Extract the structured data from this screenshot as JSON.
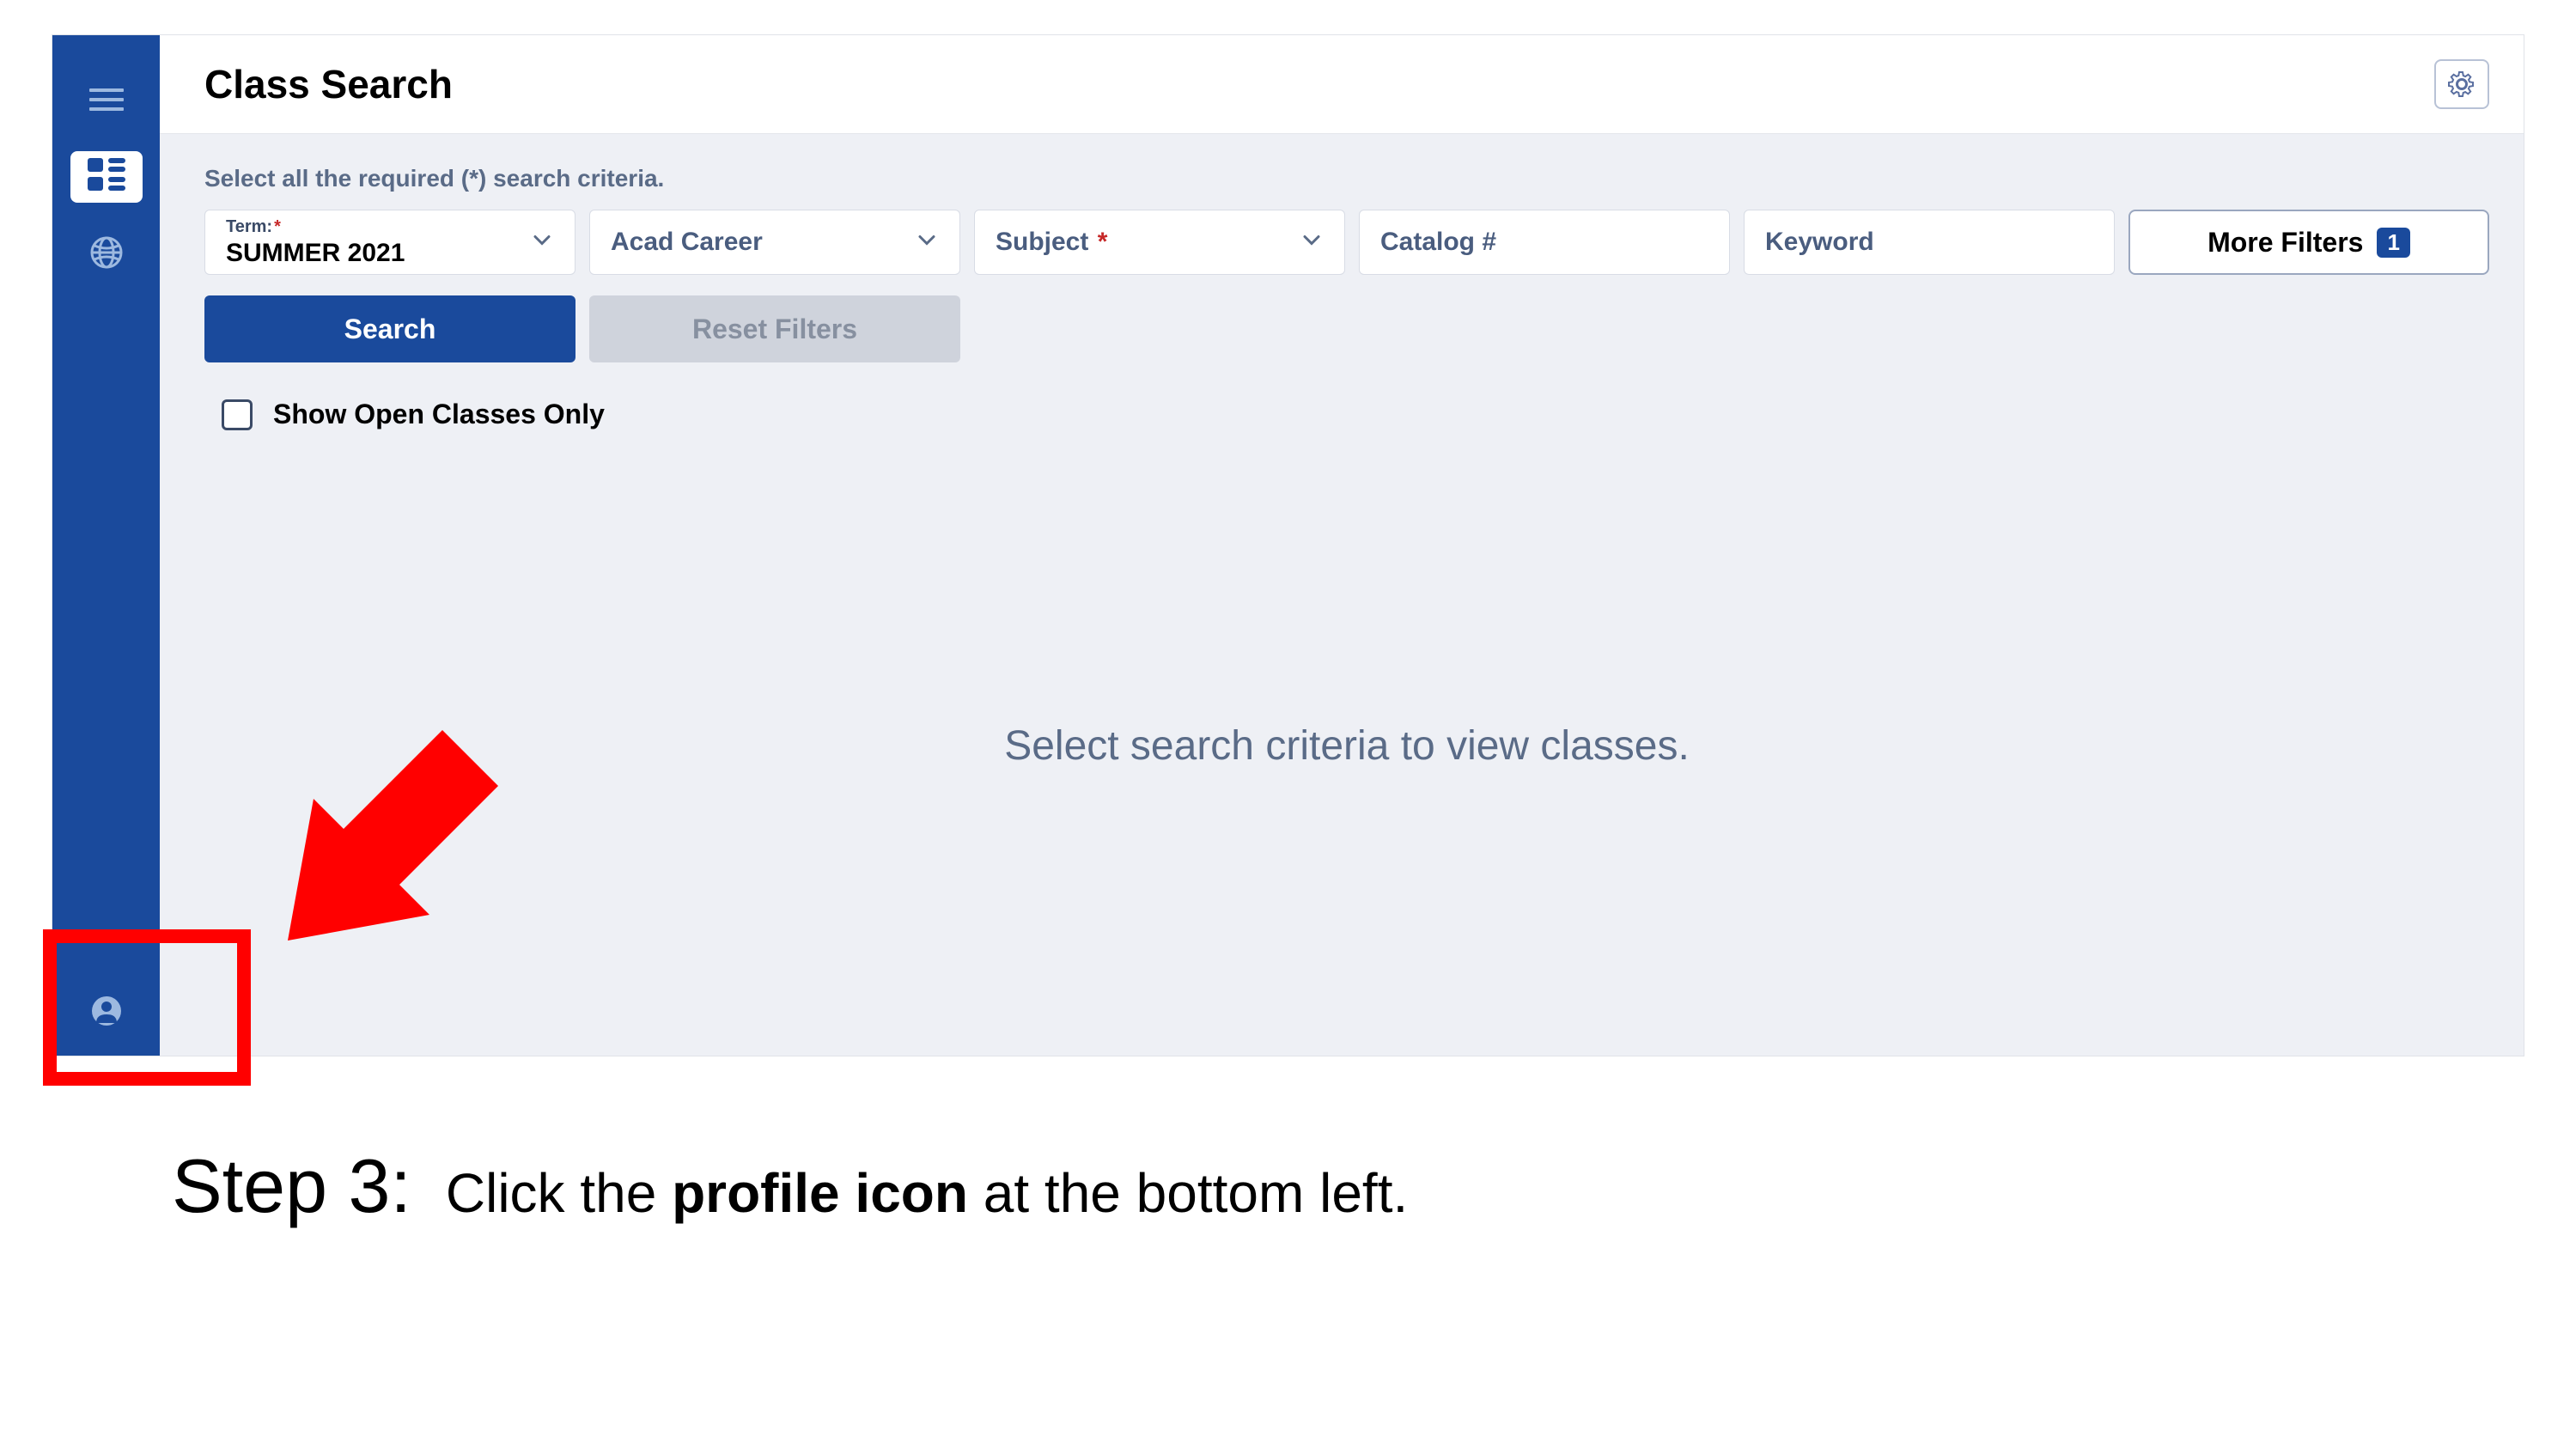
{
  "header": {
    "title": "Class Search"
  },
  "sidebar": {
    "items": [
      "menu",
      "dashboard",
      "globe",
      "profile"
    ]
  },
  "search": {
    "instruction": "Select all the required (*) search criteria.",
    "term_label": "Term:",
    "term_value": "SUMMER 2021",
    "acad_label": "Acad Career",
    "subject_label": "Subject",
    "catalog_placeholder": "Catalog #",
    "keyword_placeholder": "Keyword",
    "more_filters_label": "More Filters",
    "more_filters_count": "1",
    "search_button": "Search",
    "reset_button": "Reset Filters",
    "open_only_label": "Show Open Classes Only"
  },
  "empty_state": "Select search criteria to view classes.",
  "annotation": {
    "step_label": "Step 3:",
    "step_text_pre": "Click the ",
    "step_text_bold": "profile icon",
    "step_text_post": " at the bottom left."
  }
}
